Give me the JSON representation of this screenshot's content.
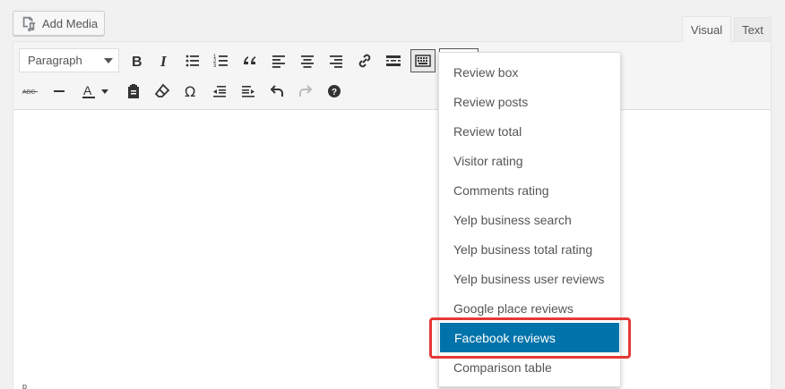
{
  "add_media": {
    "label": "Add Media",
    "icon": "media-icon"
  },
  "tabs": {
    "visual": "Visual",
    "text": "Text"
  },
  "toolbar": {
    "format_select": "Paragraph",
    "row1": [
      "bold",
      "italic",
      "bulleted-list",
      "numbered-list",
      "blockquote",
      "align-left",
      "align-center",
      "align-right",
      "insert-link",
      "read-more",
      "toolbar-toggle"
    ],
    "row2": [
      "strikethrough",
      "horizontal-line",
      "text-color",
      "paste-as-text",
      "clear-formatting",
      "special-character",
      "decrease-indent",
      "increase-indent",
      "undo",
      "redo",
      "keyboard-shortcuts"
    ]
  },
  "status_path": "p",
  "dropdown": {
    "items": [
      "Review box",
      "Review posts",
      "Review total",
      "Visitor rating",
      "Comments rating",
      "Yelp business search",
      "Yelp business total rating",
      "Yelp business user reviews",
      "Google place reviews",
      "Facebook reviews",
      "Comparison table"
    ],
    "active_index": 9
  },
  "colors": {
    "accent": "#0073aa",
    "highlight": "#e53935"
  }
}
